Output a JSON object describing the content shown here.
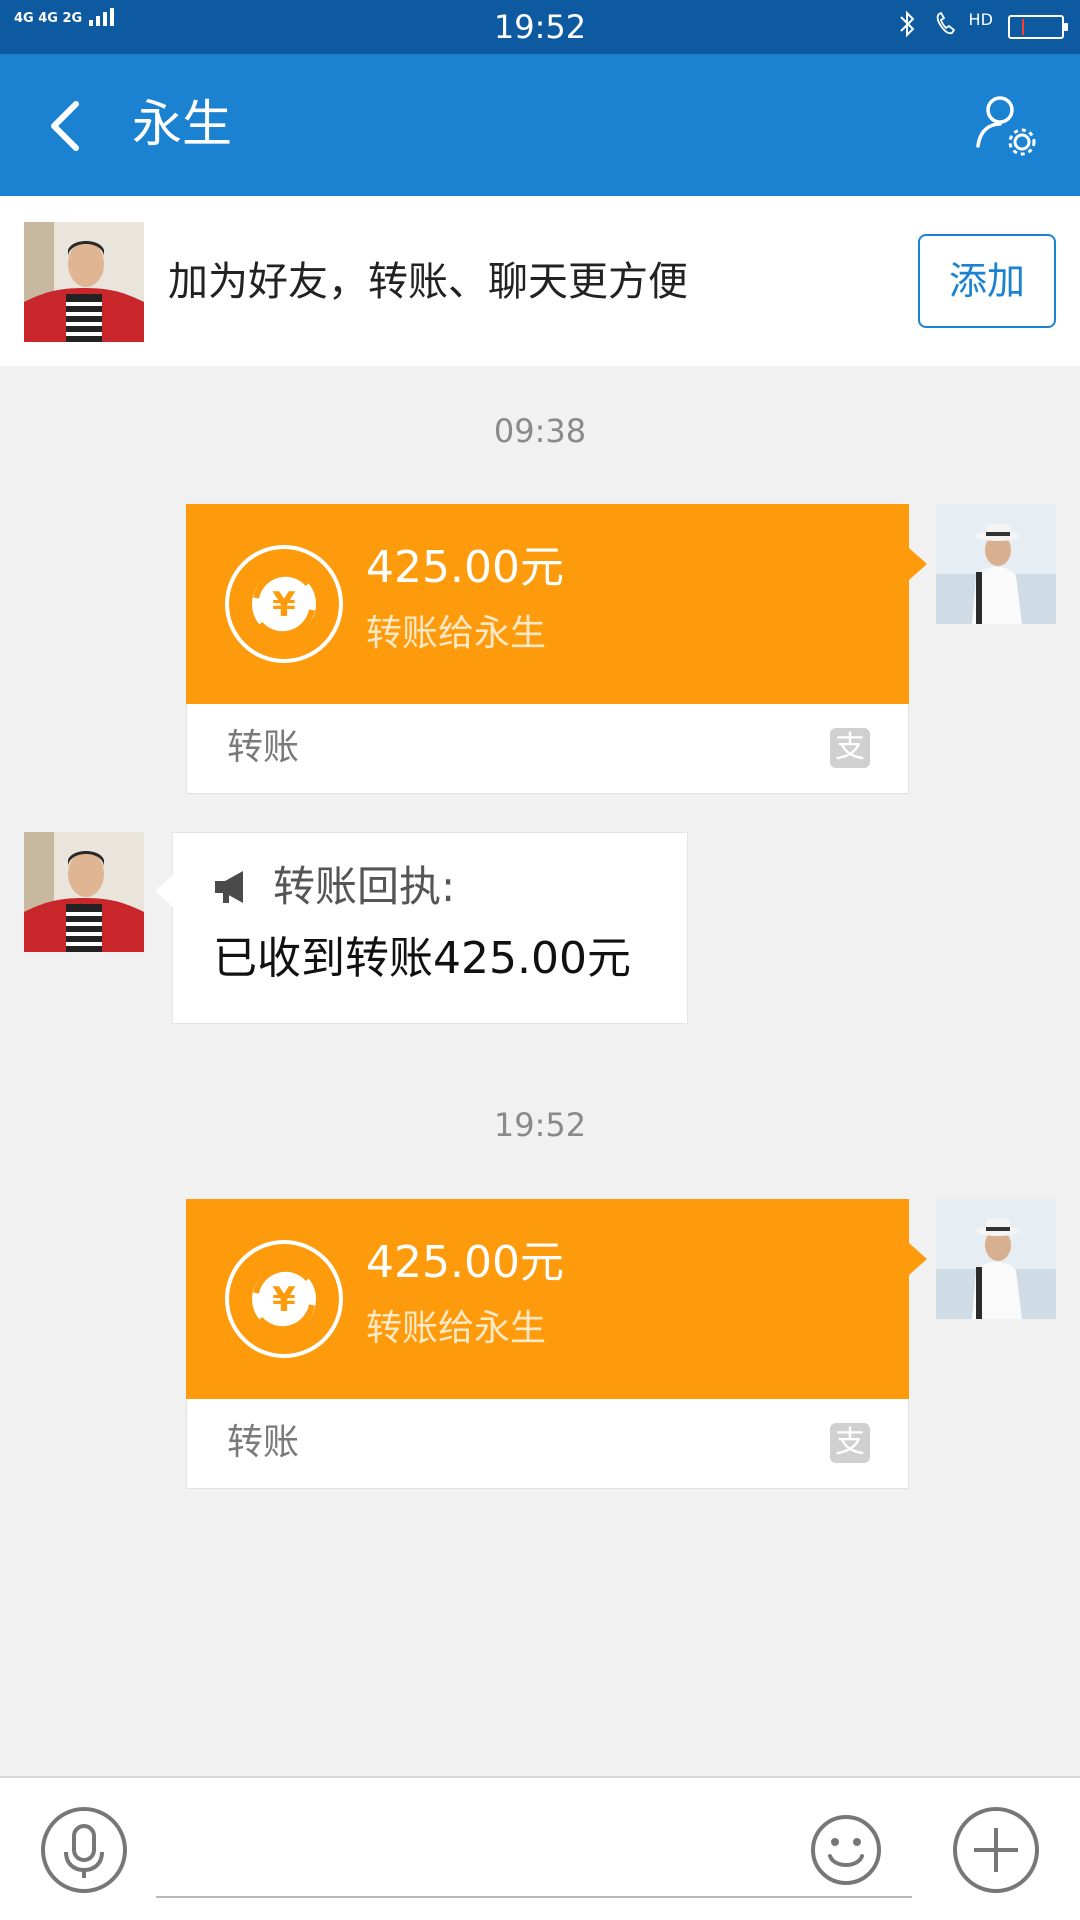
{
  "status_bar": {
    "signal_text": "4G 4G 2G",
    "time": "19:52",
    "hd_label": "HD",
    "icons": [
      "signal-icon",
      "bluetooth-icon",
      "hd-call-icon",
      "battery-icon"
    ],
    "battery_level": 0.05
  },
  "header": {
    "title": "永生",
    "icons": [
      "back-chevron-icon",
      "profile-settings-icon"
    ]
  },
  "friend_banner": {
    "text": "加为好友，转账、聊天更方便",
    "add_label": "添加"
  },
  "messages": [
    {
      "type": "timestamp",
      "text": "09:38"
    },
    {
      "type": "transfer",
      "side": "right",
      "amount": "425.00元",
      "subtitle": "转账给永生",
      "label": "转账"
    },
    {
      "type": "receipt",
      "side": "left",
      "title": "转账回执:",
      "body": "已收到转账425.00元"
    },
    {
      "type": "timestamp",
      "text": "19:52"
    },
    {
      "type": "transfer",
      "side": "right",
      "amount": "425.00元",
      "subtitle": "转账给永生",
      "label": "转账"
    }
  ],
  "alipay_glyph": "支",
  "input_bar": {
    "icons": [
      "microphone-icon",
      "emoji-icon",
      "plus-icon"
    ]
  },
  "colors": {
    "status_bar": "#0d5aa1",
    "title_bar": "#1b82d2",
    "transfer_card": "#fe9b0d",
    "battery_low": "#ff3b30"
  }
}
